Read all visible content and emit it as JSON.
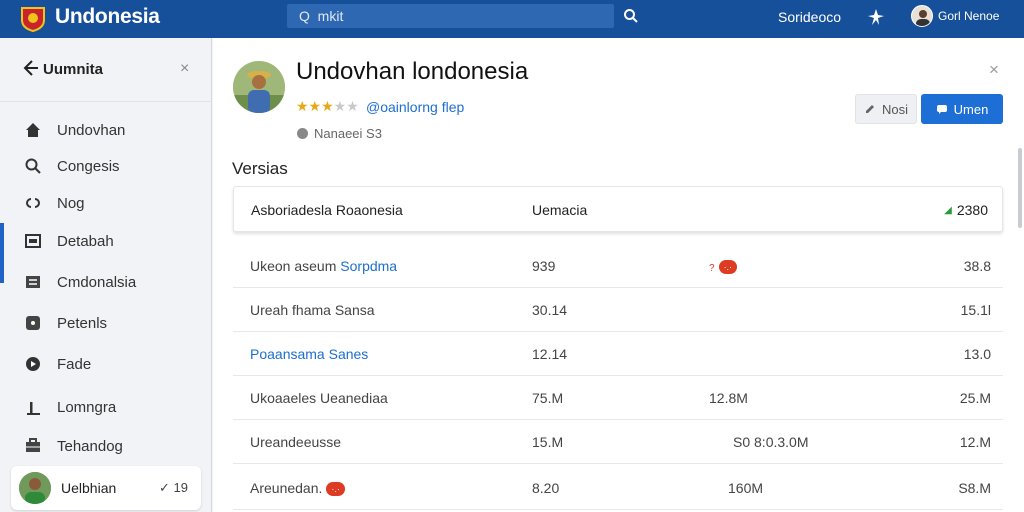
{
  "app": {
    "title": "Undonesia"
  },
  "search": {
    "value": "Q  mkit"
  },
  "topbar": {
    "link": "Sorideoco",
    "user_name": "Gorl Nenoe"
  },
  "sidebar": {
    "title": "Uumnita",
    "items": [
      {
        "label": "Undovhan",
        "icon": "home-icon"
      },
      {
        "label": "Congesis",
        "icon": "search-icon"
      },
      {
        "label": "Nog",
        "icon": "link-icon"
      },
      {
        "label": "Detabah",
        "icon": "image-icon"
      },
      {
        "label": "Cmdonalsia",
        "icon": "document-icon"
      },
      {
        "label": "Petenls",
        "icon": "tag-icon"
      },
      {
        "label": "Fade",
        "icon": "circle-icon"
      },
      {
        "label": "Lomngra",
        "icon": "chart-icon"
      },
      {
        "label": "Tehandog",
        "icon": "briefcase-icon"
      }
    ],
    "user": {
      "name": "Uelbhian",
      "badge": "✓ 19"
    }
  },
  "profile": {
    "name": "Undovhan londonesia",
    "rating": 3,
    "rating_max": 5,
    "link": "@oainlorng flep",
    "meta": "Nanaeei S3",
    "ghost_button": "Nosi",
    "primary_button": "Umen"
  },
  "section": {
    "title": "Versias"
  },
  "table": {
    "header": {
      "col1": "Asboriadesla Roaonesia",
      "col2": "Uemacia",
      "col4": "2380"
    },
    "rows": [
      {
        "c1a": "Ukeon aseum ",
        "c1b": "Sorpdma",
        "c2": "939",
        "c3": "?",
        "c3pill": "·.·",
        "c4": "38.8"
      },
      {
        "c1a": "Ureah fhama Sansa",
        "c1b": "",
        "c2": "30.14",
        "c3": "",
        "c3pill": "",
        "c4": "15.1l"
      },
      {
        "c1a": "",
        "c1b": "Poaansama Sanes",
        "c2": "12.14",
        "c3": "",
        "c3pill": "",
        "c4": "13.0"
      },
      {
        "c1a": "Ukoaaeles Ueanediaa",
        "c1b": "",
        "c2": "75.M",
        "c3": "12.8M",
        "c3pill": "",
        "c4": "25.M"
      },
      {
        "c1a": "Ureandeeusse",
        "c1b": "",
        "c2": "15.M",
        "c3": "S0 8:0.3.0M",
        "c3pill": "",
        "c4": "12.M"
      },
      {
        "c1a": "Areunedan.",
        "c1b": "",
        "c2": "8.20",
        "c3": "160M",
        "c3pill": "",
        "c4": "S8.M",
        "c1pill": "·.·"
      }
    ]
  },
  "colors": {
    "topbar": "#16509b",
    "accent": "#1d6fd6",
    "link": "#1d6fcf",
    "badge": "#dd3b22",
    "star": "#e6a817"
  }
}
